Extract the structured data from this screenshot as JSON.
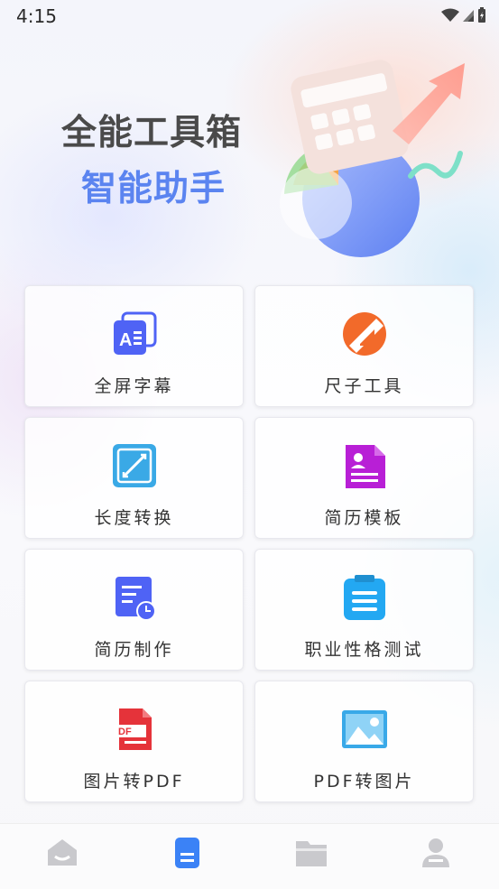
{
  "status": {
    "time": "4:15"
  },
  "hero": {
    "title": "全能工具箱",
    "subtitle": "智能助手"
  },
  "tools": [
    {
      "label": "全屏字幕",
      "icon": "subtitle-icon"
    },
    {
      "label": "尺子工具",
      "icon": "ruler-icon"
    },
    {
      "label": "长度转换",
      "icon": "length-convert-icon"
    },
    {
      "label": "简历模板",
      "icon": "resume-template-icon"
    },
    {
      "label": "简历制作",
      "icon": "resume-make-icon"
    },
    {
      "label": "职业性格测试",
      "icon": "clipboard-icon"
    },
    {
      "label": "图片转PDF",
      "icon": "pdf-icon"
    },
    {
      "label": "PDF转图片",
      "icon": "image-icon"
    }
  ],
  "tabbar": {
    "active": "documents",
    "items": [
      "home-icon",
      "document-icon",
      "folder-icon",
      "profile-icon"
    ]
  },
  "colors": {
    "accent": "#3b82f6",
    "subtitle": "#5b84f0",
    "inactive_tab": "#c8c8cc"
  }
}
